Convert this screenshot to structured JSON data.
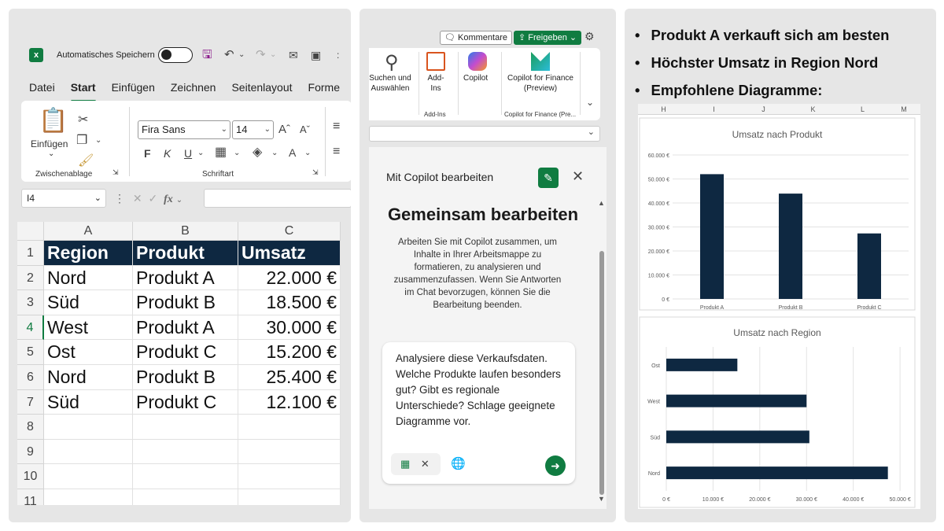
{
  "excel": {
    "autosave_label": "Automatisches Speichern",
    "menu_tabs": [
      "Datei",
      "Start",
      "Einfügen",
      "Zeichnen",
      "Seitenlayout",
      "Forme"
    ],
    "active_tab": "Start",
    "ribbon": {
      "paste_label": "Einfügen",
      "clipboard_group": "Zwischenablage",
      "font_group": "Schriftart",
      "font_name": "Fira Sans",
      "font_size": "14",
      "bold": "F",
      "italic": "K",
      "underline": "U",
      "font_color_glyph": "A"
    },
    "namebox": "I4",
    "fx": "fx",
    "columns": [
      "A",
      "B",
      "C"
    ],
    "rows": [
      "1",
      "2",
      "3",
      "4",
      "5",
      "6",
      "7",
      "8",
      "9",
      "10",
      "11"
    ],
    "header": [
      "Region",
      "Produkt",
      "Umsatz"
    ],
    "data": [
      [
        "Nord",
        "Produkt A",
        "22.000 €"
      ],
      [
        "Süd",
        "Produkt B",
        "18.500 €"
      ],
      [
        "West",
        "Produkt A",
        "30.000 €"
      ],
      [
        "Ost",
        "Produkt C",
        "15.200 €"
      ],
      [
        "Nord",
        "Produkt B",
        "25.400 €"
      ],
      [
        "Süd",
        "Produkt C",
        "12.100 €"
      ]
    ],
    "header_color": "#0e2841",
    "accent": "#107c41"
  },
  "copilot": {
    "comments_label": "Kommentare",
    "share_label": "Freigeben",
    "ribbon": {
      "search_label": "Suchen und Auswählen",
      "addins_label": "Add-Ins",
      "addins_group": "Add-Ins",
      "copilot_label": "Copilot",
      "finance_label": "Copilot for Finance (Preview)",
      "finance_group": "Copilot for Finance (Pre..."
    },
    "pane_title": "Mit Copilot bearbeiten",
    "heading": "Gemeinsam bearbeiten",
    "description": "Arbeiten Sie mit Copilot zusammen, um Inhalte in Ihrer Arbeitsmappe zu formatieren, zu analysieren und zusammenzufassen. Wenn Sie Antworten im Chat bevorzugen, können Sie die Bearbeitung beenden.",
    "prompt": "Analysiere diese Verkaufsdaten. Welche Produkte laufen besonders gut? Gibt es regionale Unterschiede? Schlage geeignete Diagramme vor."
  },
  "results": {
    "bullets": [
      "Produkt A verkauft sich am besten",
      "Höchster Umsatz in Region Nord",
      "Empfohlene Diagramme:"
    ],
    "sheet_columns": [
      "H",
      "I",
      "J",
      "K",
      "L",
      "M"
    ]
  },
  "chart_data": [
    {
      "type": "bar",
      "title": "Umsatz nach Produkt",
      "categories": [
        "Produkt A",
        "Produkt B",
        "Produkt C"
      ],
      "values": [
        52000,
        43900,
        27300
      ],
      "yticks": [
        "0 €",
        "10.000 €",
        "20.000 €",
        "30.000 €",
        "40.000 €",
        "50.000 €",
        "60.000 €"
      ],
      "ylim": [
        0,
        60000
      ],
      "grid": true,
      "color": "#0e2841"
    },
    {
      "type": "bar",
      "orientation": "horizontal",
      "title": "Umsatz nach Region",
      "categories": [
        "Ost",
        "West",
        "Süd",
        "Nord"
      ],
      "values": [
        15200,
        30000,
        30600,
        47400
      ],
      "xticks": [
        "0 €",
        "10.000 €",
        "20.000 €",
        "30.000 €",
        "40.000 €",
        "50.000 €"
      ],
      "xlim": [
        0,
        52000
      ],
      "grid": true,
      "color": "#0e2841"
    }
  ]
}
